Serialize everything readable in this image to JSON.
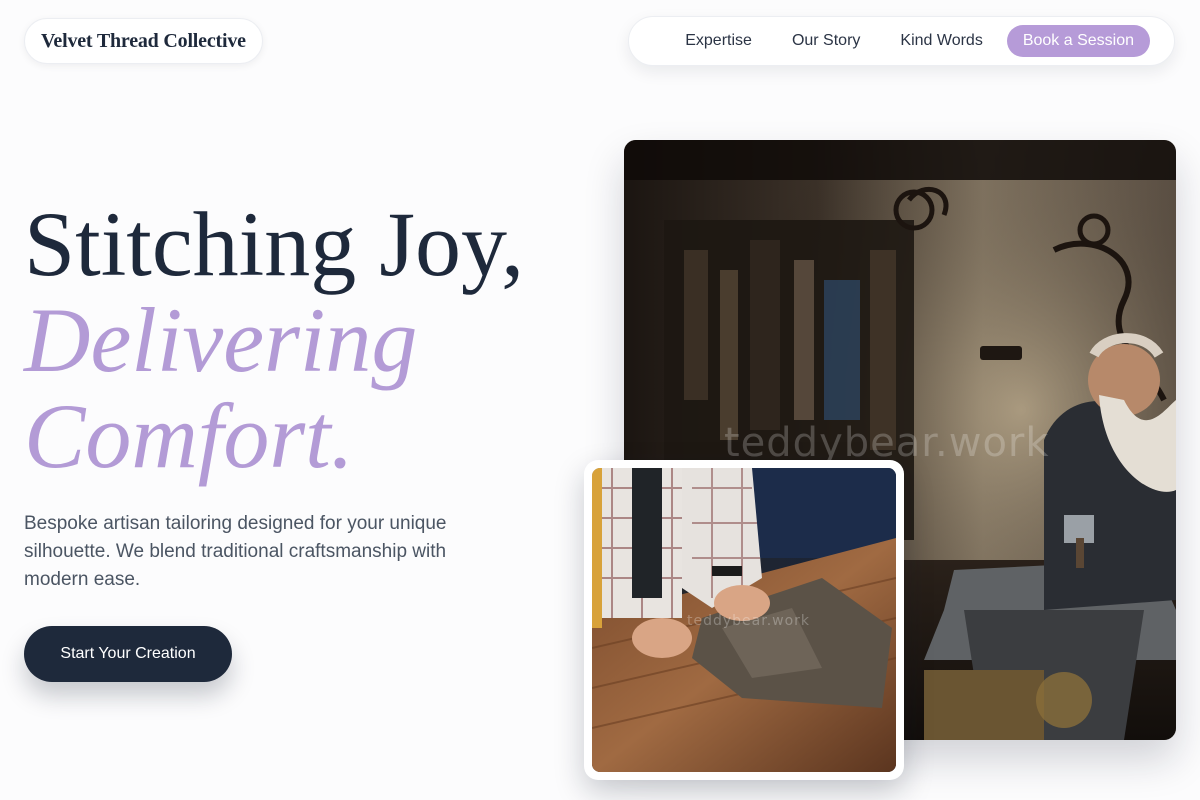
{
  "brand": {
    "name": "Velvet Thread Collective"
  },
  "nav": {
    "links": [
      "Expertise",
      "Our Story",
      "Kind Words"
    ],
    "cta": "Book a Session"
  },
  "hero": {
    "headline_line1": "Stitching Joy,",
    "headline_line2": "Delivering",
    "headline_line3": "Comfort.",
    "description": "Bespoke artisan tailoring designed for your unique silhouette. We blend traditional craftsmanship with modern ease.",
    "button_label": "Start Your Creation"
  },
  "images": {
    "main_watermark": "teddybear.work",
    "inset_watermark": "teddybear.work"
  },
  "colors": {
    "accent": "#b69bd8",
    "dark": "#1e293b",
    "background": "#fcfcfd"
  }
}
